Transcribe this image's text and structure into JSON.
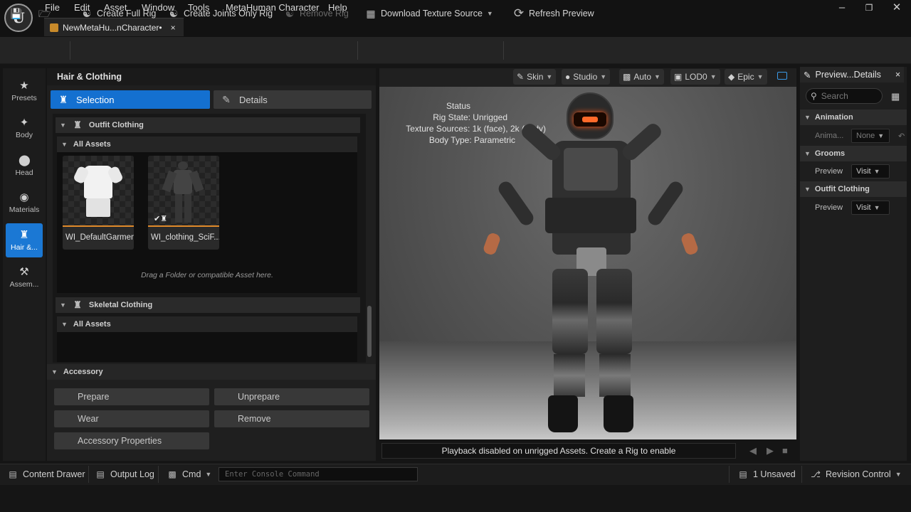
{
  "menu": [
    "File",
    "Edit",
    "Asset",
    "Window",
    "Tools",
    "MetaHuman Character",
    "Help"
  ],
  "doc_tab": {
    "label": "NewMetaHu...nCharacter•",
    "close": "×"
  },
  "toolbar": {
    "create_full_rig": "Create Full Rig",
    "create_joints_rig": "Create Joints Only Rig",
    "remove_rig": "Remove Rig",
    "download_texture": "Download Texture Source",
    "refresh_preview": "Refresh Preview"
  },
  "left_nav": [
    {
      "label": "Presets",
      "icon": "star-icon"
    },
    {
      "label": "Body",
      "icon": "body-icon"
    },
    {
      "label": "Head",
      "icon": "head-icon"
    },
    {
      "label": "Materials",
      "icon": "materials-icon"
    },
    {
      "label": "Hair &...",
      "icon": "hair-clothing-icon"
    },
    {
      "label": "Assem...",
      "icon": "hammer-icon"
    }
  ],
  "panel": {
    "title": "Hair & Clothing",
    "mode_selection": "Selection",
    "mode_details": "Details",
    "outfit_section": "Outfit Clothing",
    "outfit_all_assets": "All Assets",
    "assets": [
      "WI_DefaultGarment",
      "WI_clothing_SciF..."
    ],
    "drop_hint": "Drag a Folder or compatible Asset here.",
    "skeletal_section": "Skeletal Clothing",
    "skeletal_all_assets": "All Assets",
    "accessory_section": "Accessory",
    "accessory_buttons": {
      "prepare": "Prepare",
      "unprepare": "Unprepare",
      "wear": "Wear",
      "remove": "Remove",
      "properties": "Accessory Properties"
    }
  },
  "viewport": {
    "buttons": {
      "skin": "Skin",
      "studio": "Studio",
      "auto": "Auto",
      "lod": "LOD0",
      "quality": "Epic"
    },
    "status_title": "Status",
    "status_lines": [
      "Rig State: Unrigged",
      "Texture Sources: 1k (face), 2k (body)",
      "Body Type: Parametric"
    ],
    "playback_msg": "Playback disabled on unrigged Assets. Create a Rig to enable"
  },
  "right_panel": {
    "tab": "Preview...Details",
    "close": "×",
    "search_placeholder": "Search",
    "animation_section": "Animation",
    "animation_label": "Anima...",
    "animation_value": "None",
    "grooms_section": "Grooms",
    "grooms_label": "Preview",
    "grooms_value": "Visit",
    "outfit_section": "Outfit Clothing",
    "outfit_label": "Preview",
    "outfit_value": "Visit"
  },
  "statusbar": {
    "content_drawer": "Content Drawer",
    "output_log": "Output Log",
    "cmd": "Cmd",
    "console_placeholder": "Enter Console Command",
    "unsaved": "1 Unsaved",
    "revision_control": "Revision Control"
  },
  "colors": {
    "accent": "#1470d0",
    "orange": "#e08a2a",
    "panel": "#1f1f1f"
  }
}
